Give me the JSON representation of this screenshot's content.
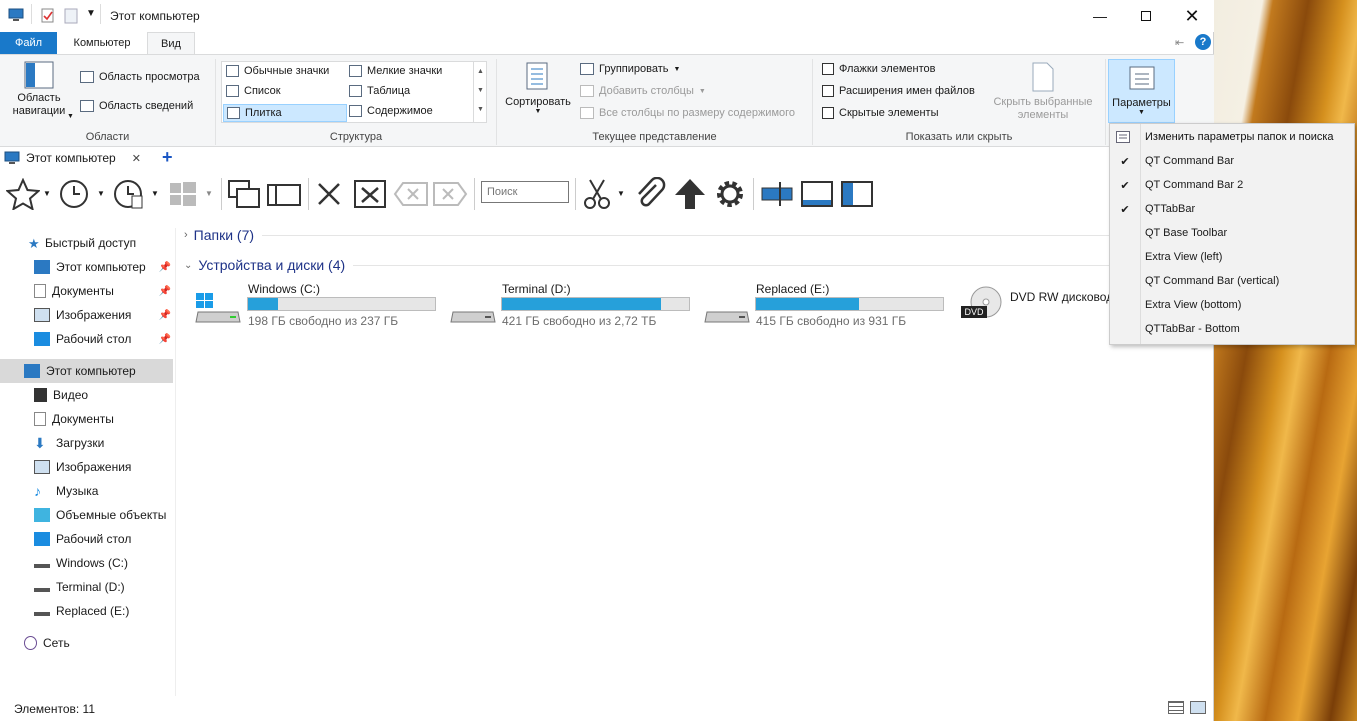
{
  "window": {
    "title": "Этот компьютер"
  },
  "ribbon": {
    "tabs": [
      "Файл",
      "Компьютер",
      "Вид"
    ],
    "panes": {
      "nav_pane": "Область навигации",
      "preview": "Область просмотра",
      "details": "Область сведений",
      "group": "Области"
    },
    "layout": {
      "items": [
        "Обычные значки",
        "Мелкие значки",
        "Список",
        "Таблица",
        "Плитка",
        "Содержимое"
      ],
      "selected": "Плитка",
      "group": "Структура"
    },
    "current_view": {
      "sort": "Сортировать",
      "group_by": "Группировать",
      "add_columns": "Добавить столбцы",
      "fit_columns": "Все столбцы по размеру содержимого",
      "group": "Текущее представление"
    },
    "show_hide": {
      "checkbox_items": "Флажки элементов",
      "extensions": "Расширения имен файлов",
      "hidden": "Скрытые элементы",
      "hide_selected": "Скрыть выбранные элементы",
      "group": "Показать или скрыть"
    },
    "options": "Параметры"
  },
  "qt_tab": {
    "label": "Этот компьютер",
    "close": "✕",
    "add": "+"
  },
  "toolbar": {
    "search_placeholder": "Поиск"
  },
  "nav": {
    "quick_access": "Быстрый доступ",
    "quick_items": [
      "Этот компьютер",
      "Документы",
      "Изображения",
      "Рабочий стол"
    ],
    "this_pc": "Этот компьютер",
    "pc_items": [
      "Видео",
      "Документы",
      "Загрузки",
      "Изображения",
      "Музыка",
      "Объемные объекты",
      "Рабочий стол",
      "Windows (C:)",
      "Terminal (D:)",
      "Replaced (E:)"
    ],
    "network": "Сеть"
  },
  "content": {
    "folders_group": "Папки (7)",
    "devices_group": "Устройства и диски (4)",
    "drives": [
      {
        "name": "Windows (C:)",
        "free": "198 ГБ свободно из 237 ГБ",
        "used_fraction": 0.16
      },
      {
        "name": "Terminal (D:)",
        "free": "421 ГБ свободно из 2,72 ТБ",
        "used_fraction": 0.85
      },
      {
        "name": "Replaced (E:)",
        "free": "415 ГБ свободно из 931 ГБ",
        "used_fraction": 0.55
      }
    ],
    "dvd": {
      "name": "DVD RW дисковод",
      "badge": "DVD"
    }
  },
  "menu": {
    "items": [
      {
        "label": "Изменить параметры папок и поиска",
        "checked": false
      },
      {
        "label": "QT Command Bar",
        "checked": true
      },
      {
        "label": "QT Command Bar 2",
        "checked": true
      },
      {
        "label": "QTTabBar",
        "checked": true
      },
      {
        "label": "QT Base Toolbar",
        "checked": false
      },
      {
        "label": "Extra View (left)",
        "checked": false
      },
      {
        "label": "QT Command Bar (vertical)",
        "checked": false
      },
      {
        "label": "Extra View (bottom)",
        "checked": false
      },
      {
        "label": "QTTabBar - Bottom",
        "checked": false
      }
    ],
    "check_glyph": "✔"
  },
  "status": {
    "items": "Элементов: 11"
  },
  "colors": {
    "accent": "#1979ca",
    "bar": "#26a0da"
  }
}
